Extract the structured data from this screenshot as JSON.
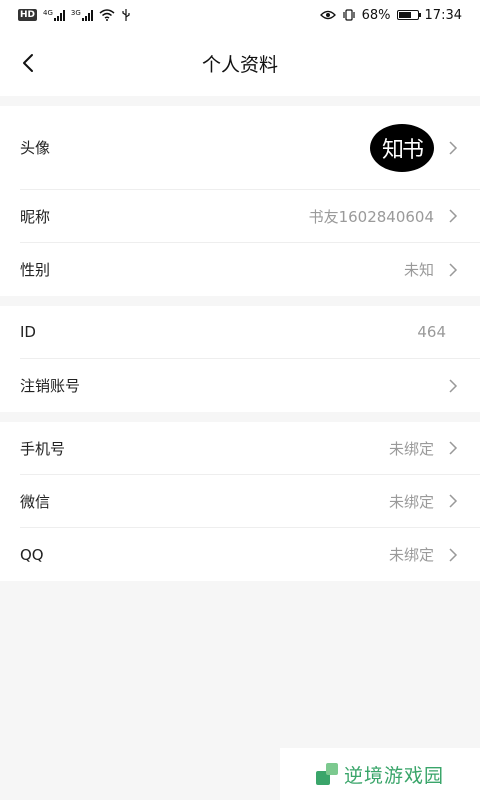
{
  "status_bar": {
    "hd_label": "HD",
    "net1": "4G",
    "net2": "3G",
    "battery_percent_text": "68%",
    "battery_level": 0.68,
    "time": "17:34"
  },
  "header": {
    "title": "个人资料",
    "back_icon": "chevron-left-icon"
  },
  "sections": [
    {
      "rows": [
        {
          "label": "头像",
          "avatar_text": "知书"
        },
        {
          "label": "昵称",
          "value": "书友1602840604"
        },
        {
          "label": "性别",
          "value": "未知"
        }
      ]
    },
    {
      "rows": [
        {
          "label": "ID",
          "value": "464"
        },
        {
          "label": "注销账号"
        }
      ]
    },
    {
      "rows": [
        {
          "label": "手机号",
          "value": "未绑定"
        },
        {
          "label": "微信",
          "value": "未绑定"
        },
        {
          "label": "QQ",
          "value": "未绑定"
        }
      ]
    }
  ],
  "watermark": {
    "text": "逆境游戏园",
    "color": "#3aa56a"
  }
}
